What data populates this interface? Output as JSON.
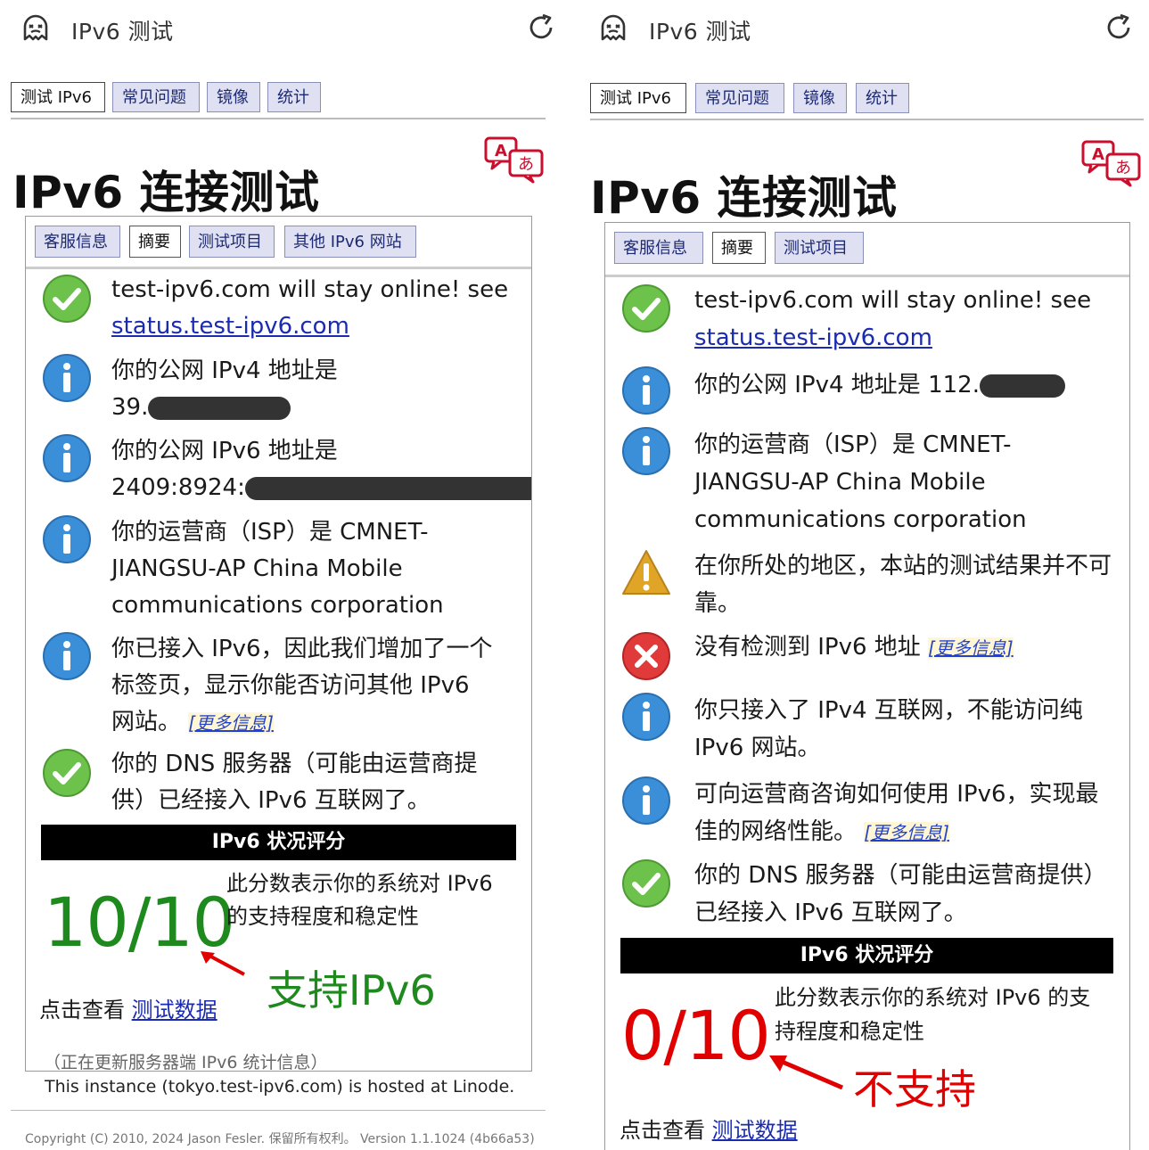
{
  "app_title": "IPv6 测试",
  "nav_tabs": [
    "测试 IPv6",
    "常见问题",
    "镜像",
    "统计"
  ],
  "page_title": "IPv6 连接测试",
  "colors": {
    "tab_bg": "#dfe0f2",
    "link": "#1a2bb0",
    "ok": "#6cc24a",
    "info": "#3b8fd9",
    "warn": "#e0a526",
    "error": "#e03a3a",
    "score_ok": "#1e8a1e",
    "score_bad": "#e00000",
    "annotation_arrow": "#e00000"
  },
  "left": {
    "subtabs": [
      "客服信息",
      "摘要",
      "测试项目",
      "其他 IPv6 网站"
    ],
    "items": [
      {
        "icon": "check-icon",
        "text": "test-ipv6.com will stay online! see",
        "link": "status.test-ipv6.com"
      },
      {
        "icon": "info-icon",
        "text": "你的公网 IPv4 地址是",
        "value": "39."
      },
      {
        "icon": "info-icon",
        "text": "你的公网 IPv6 地址是",
        "value": "2409:8924:"
      },
      {
        "icon": "info-icon",
        "text": "你的运营商（ISP）是 CMNET-JIANGSU-AP China Mobile communications corporation"
      },
      {
        "icon": "info-icon",
        "text": "你已接入 IPv6，因此我们增加了一个标签页，显示你能否访问其他 IPv6 网站。",
        "more": "[更多信息]"
      },
      {
        "icon": "check-icon",
        "text": "你的 DNS 服务器（可能由运营商提供）已经接入 IPv6 互联网了。"
      }
    ],
    "score_header": "IPv6 状况评分",
    "score": "10/10",
    "score_desc": "此分数表示你的系统对 IPv6 的支持程度和稳定性",
    "annotation": "支持IPv6",
    "click_prefix": "点击查看",
    "click_link": "测试数据",
    "updating": "（正在更新服务器端 IPv6 统计信息）",
    "hosted": "This instance (tokyo.test-ipv6.com) is hosted at Linode.",
    "footer": "Copyright (C) 2010, 2024 Jason Fesler. 保留所有权利。 Version 1.1.1024 (4b66a53)"
  },
  "right": {
    "subtabs": [
      "客服信息",
      "摘要",
      "测试项目"
    ],
    "items": [
      {
        "icon": "check-icon",
        "text": "test-ipv6.com will stay online! see",
        "link": "status.test-ipv6.com"
      },
      {
        "icon": "info-icon",
        "text": "你的公网 IPv4 地址是 112."
      },
      {
        "icon": "info-icon",
        "text": "你的运营商（ISP）是 CMNET-JIANGSU-AP China Mobile communications corporation"
      },
      {
        "icon": "warning-icon",
        "text": "在你所处的地区，本站的测试结果并不可靠。"
      },
      {
        "icon": "error-icon",
        "text": "没有检测到 IPv6 地址",
        "more": "[更多信息]"
      },
      {
        "icon": "info-icon",
        "text": "你只接入了 IPv4 互联网，不能访问纯 IPv6 网站。"
      },
      {
        "icon": "info-icon",
        "text": "可向运营商咨询如何使用 IPv6，实现最佳的网络性能。",
        "more": "[更多信息]"
      },
      {
        "icon": "check-icon",
        "text": "你的 DNS 服务器（可能由运营商提供）已经接入 IPv6 互联网了。"
      }
    ],
    "score_header": "IPv6 状况评分",
    "score": "0/10",
    "score_desc": "此分数表示你的系统对 IPv6 的支持程度和稳定性",
    "annotation": "不支持",
    "click_prefix": "点击查看",
    "click_link": "测试数据"
  }
}
